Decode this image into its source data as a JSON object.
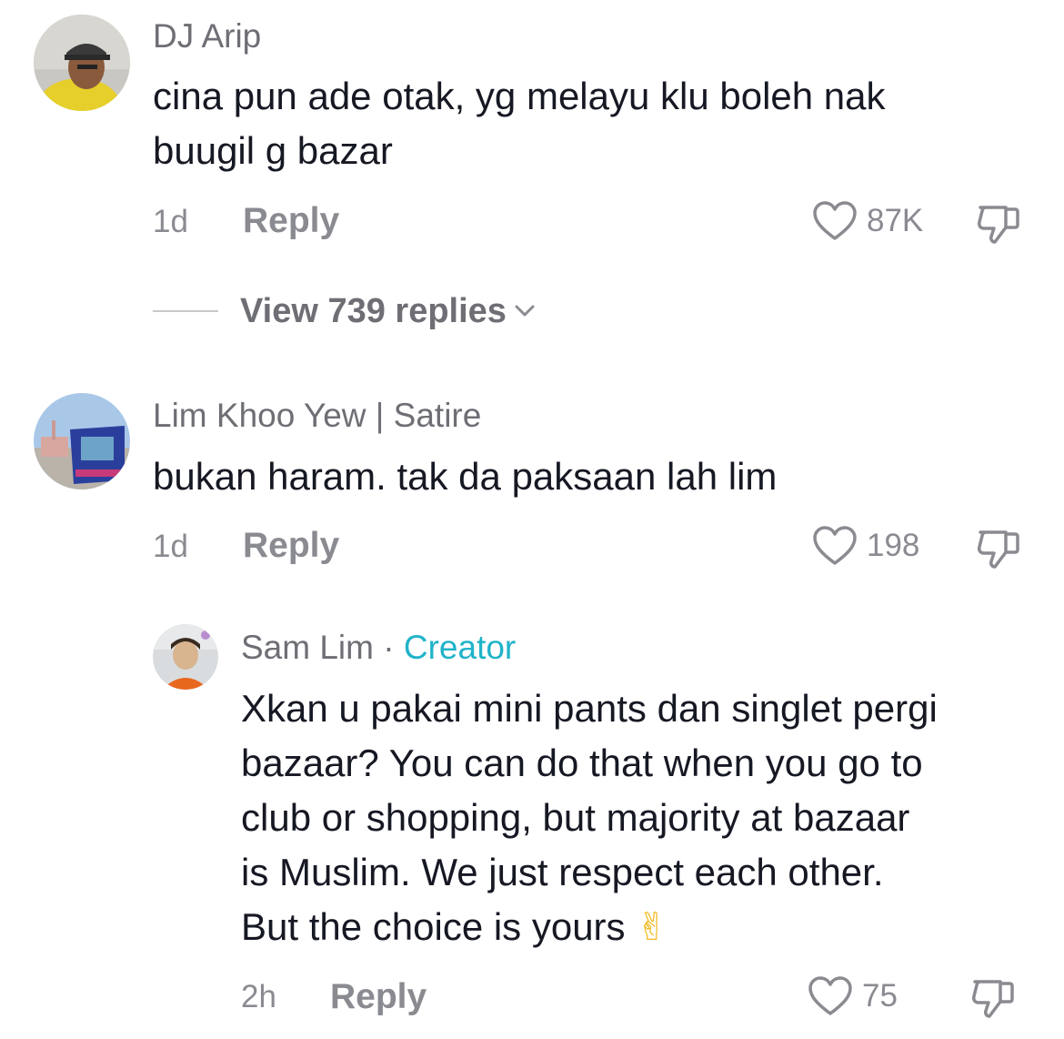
{
  "comments": [
    {
      "username": "DJ Arip",
      "text_lines": [
        "cina pun ade otak, yg melayu klu boleh nak",
        "buugil g bazar"
      ],
      "time": "1d",
      "reply_label": "Reply",
      "likes": "87K",
      "view_replies": "View 739 replies"
    },
    {
      "username": "Lim Khoo Yew | Satire",
      "text_lines": [
        "bukan haram. tak da paksaan lah lim"
      ],
      "time": "1d",
      "reply_label": "Reply",
      "likes": "198"
    },
    {
      "username": "Sam Lim",
      "separator": " · ",
      "badge": "Creator",
      "text_lines": [
        "Xkan u pakai mini pants dan singlet pergi",
        "bazaar? You can do that when you go to",
        "club or shopping, but majority at bazaar",
        "is Muslim. We just respect each other.",
        "But the choice is yours"
      ],
      "emoji": "✌",
      "time": "2h",
      "reply_label": "Reply",
      "likes": "75"
    }
  ],
  "icons": {
    "like": "heart-outline-icon",
    "dislike": "thumbs-down-outline-icon",
    "expand": "chevron-down-icon"
  },
  "colors": {
    "text": "#161823",
    "muted": "#8a8b91",
    "username": "#6e6e75",
    "creator": "#20b3c9"
  }
}
